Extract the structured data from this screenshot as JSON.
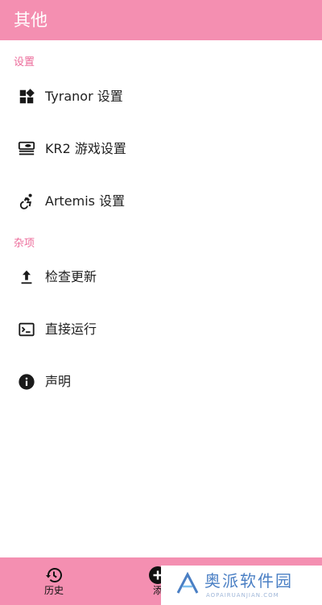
{
  "app": {
    "title": "其他"
  },
  "sections": [
    {
      "header": "设置"
    },
    {
      "header": "杂项"
    }
  ],
  "settings_items": [
    {
      "label": "Tyranor 设置",
      "icon": "widgets-icon"
    },
    {
      "label": "KR2 游戏设置",
      "icon": "engine-icon"
    },
    {
      "label": "Artemis 设置",
      "icon": "accessible-forward-icon"
    }
  ],
  "misc_items": [
    {
      "label": "检查更新",
      "icon": "upload-icon"
    },
    {
      "label": "直接运行",
      "icon": "terminal-icon"
    },
    {
      "label": "声明",
      "icon": "info-icon"
    }
  ],
  "bottom_nav": [
    {
      "label": "历史",
      "icon": "history-icon"
    },
    {
      "label": "添",
      "icon": "add-circle-icon"
    }
  ],
  "watermark": {
    "text": "奥派软件园",
    "sub": "AOPAIRUANJIAN.COM"
  },
  "colors": {
    "accent": "#f48fb1",
    "section_header": "#ec6b9a",
    "watermark": "#4a7fc4"
  }
}
